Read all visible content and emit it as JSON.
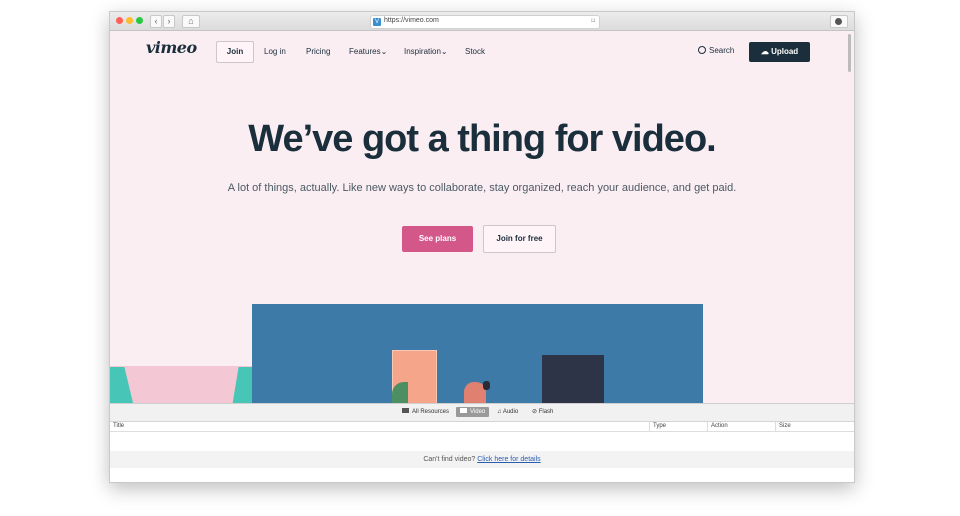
{
  "browser": {
    "url": "https://vimeo.com",
    "nav_back": "‹",
    "nav_forward": "›",
    "home_icon": "⌂",
    "url_site_icon": "V",
    "bookmark_icon": "⌑",
    "traffic_lights": [
      "#ff5f57",
      "#febc2e",
      "#28c840"
    ]
  },
  "header": {
    "logo": "vimeo",
    "join": "Join",
    "nav": {
      "login": "Log in",
      "pricing": "Pricing",
      "features": "Features⌄",
      "inspiration": "Inspiration⌄",
      "stock": "Stock"
    },
    "search": "Search",
    "upload": "Upload"
  },
  "hero": {
    "headline": "We’ve got a thing for video.",
    "subtext": "A lot of things, actually. Like new ways to collaborate, stay organized, reach your audience, and get paid.",
    "see_plans": "See plans",
    "join_free": "Join for free"
  },
  "resources": {
    "tabs": {
      "all": "All Resources",
      "video": "Video",
      "audio": "Audio",
      "flash": "Flash"
    },
    "active_tab": "Video",
    "columns": {
      "title": "Title",
      "type": "Type",
      "action": "Action",
      "size": "Size"
    },
    "footer_text": "Can't find video?",
    "footer_link": "Click here for details"
  },
  "colors": {
    "brand_dark": "#1a2e3b",
    "accent_pink": "#d4578a",
    "page_bg": "#fbeef3"
  }
}
